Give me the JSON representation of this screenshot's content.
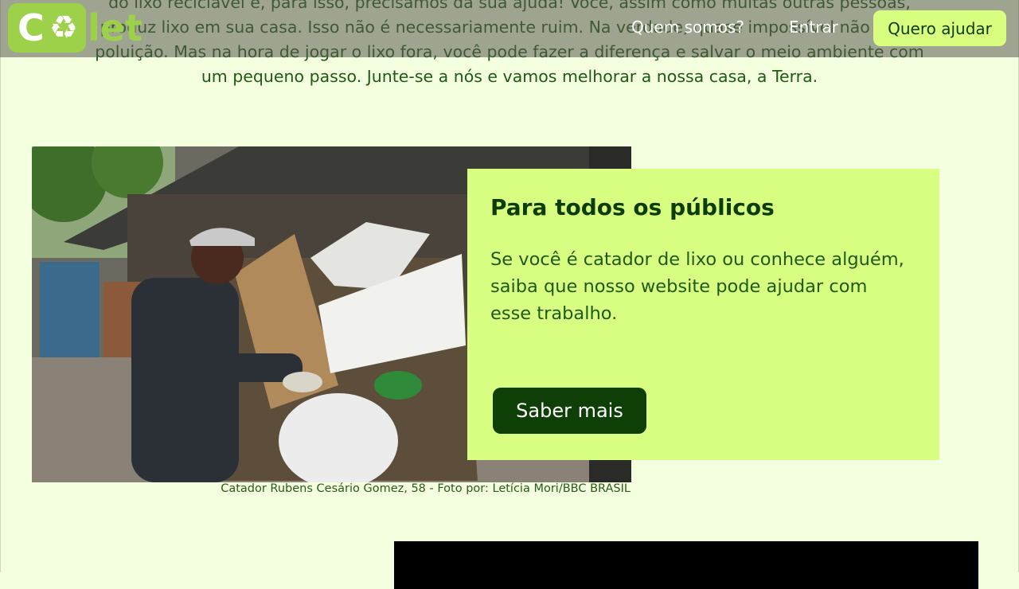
{
  "intro": {
    "text": "do lixo reciclável é, para isso, precisamos da sua ajuda! Você, assim como muitas outras pessoas, produz lixo em sua casa. Isso não é necessariamente ruim. Na verdade, quase impossível não gerar poluição. Mas na hora de jogar o lixo fora, você pode fazer a diferença e salvar o meio ambiente com um pequeno passo. Junte-se a nós e vamos melhorar a nossa casa, a Terra."
  },
  "nav": {
    "logo_start": "C",
    "logo_icon": "recycle-icon",
    "logo_end": "let",
    "about": "Quem somos?",
    "login": "Entrar",
    "cta": "Quero ajudar"
  },
  "feature": {
    "title": "Para todos os públicos",
    "text": "Se você é catador de lixo ou conhece alguém, saiba que nosso website pode ajudar com esse trabalho.",
    "button": "Saber mais",
    "caption": "Catador Rubens Cesário Gomez, 58 - Foto por: Letícia Mori/BBC BRASIL"
  },
  "colors": {
    "background": "#f4ffe0",
    "accent": "#d9ff82",
    "brand": "#9ed14a",
    "dark_green": "#0e3f07"
  }
}
